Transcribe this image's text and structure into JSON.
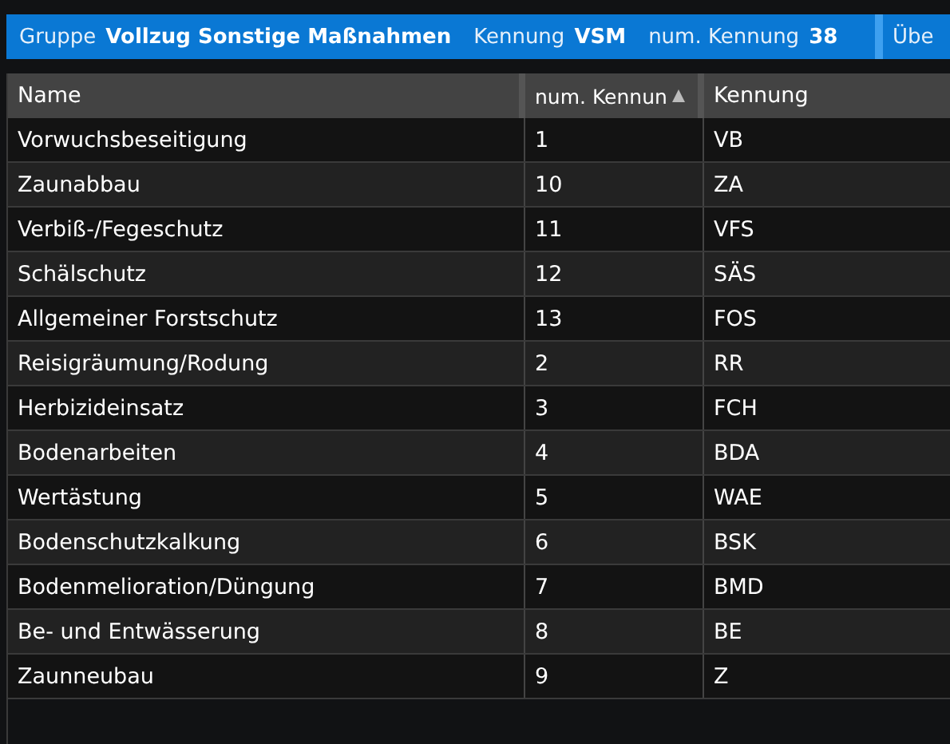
{
  "info_bar": {
    "fields": [
      {
        "label": "Gruppe",
        "value": "Vollzug Sonstige Maßnahmen"
      },
      {
        "label": "Kennung",
        "value": "VSM"
      },
      {
        "label": "num. Kennung",
        "value": "38"
      }
    ],
    "next_label": "Übe"
  },
  "table": {
    "columns": [
      {
        "label": "Name",
        "sorted": false
      },
      {
        "label": "num. Kennun",
        "sorted": true
      },
      {
        "label": "Kennung",
        "sorted": false
      }
    ],
    "rows": [
      [
        "Vorwuchsbeseitigung",
        "1",
        "VB"
      ],
      [
        "Zaunabbau",
        "10",
        "ZA"
      ],
      [
        "Verbiß-/Fegeschutz",
        "11",
        "VFS"
      ],
      [
        "Schälschutz",
        "12",
        "SÄS"
      ],
      [
        "Allgemeiner Forstschutz",
        "13",
        "FOS"
      ],
      [
        "Reisigräumung/Rodung",
        "2",
        "RR"
      ],
      [
        "Herbizideinsatz",
        "3",
        "FCH"
      ],
      [
        "Bodenarbeiten",
        "4",
        "BDA"
      ],
      [
        "Wertästung",
        "5",
        "WAE"
      ],
      [
        "Bodenschutzkalkung",
        "6",
        "BSK"
      ],
      [
        "Bodenmelioration/Düngung",
        "7",
        "BMD"
      ],
      [
        "Be- und Entwässerung",
        "8",
        "BE"
      ],
      [
        "Zaunneubau",
        "9",
        "Z"
      ]
    ]
  }
}
